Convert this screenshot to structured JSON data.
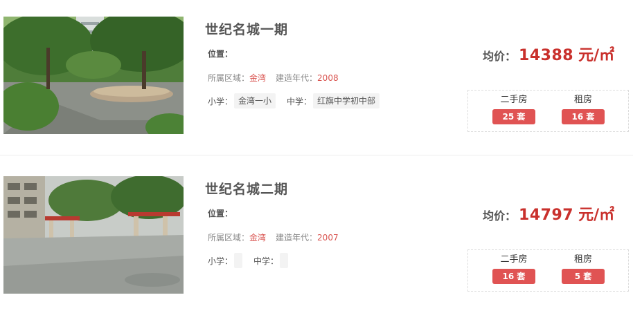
{
  "listings": [
    {
      "name": "世纪名城一期",
      "location_label": "位置：",
      "district_label": "所属区域：",
      "district": "金湾",
      "year_label": "建造年代：",
      "year": "2008",
      "primary_school_label": "小学：",
      "primary_school": "金湾一小",
      "middle_school_label": "中学：",
      "middle_school": "红旗中学初中部",
      "price_label": "均价：",
      "price": "14388",
      "price_unit": "元/㎡",
      "secondhand_label": "二手房",
      "secondhand_count": "25 套",
      "rental_label": "租房",
      "rental_count": "16 套"
    },
    {
      "name": "世纪名城二期",
      "location_label": "位置：",
      "district_label": "所属区域：",
      "district": "金湾",
      "year_label": "建造年代：",
      "year": "2007",
      "primary_school_label": "小学：",
      "primary_school": "",
      "middle_school_label": "中学：",
      "middle_school": "",
      "price_label": "均价：",
      "price": "14797",
      "price_unit": "元/㎡",
      "secondhand_label": "二手房",
      "secondhand_count": "16 套",
      "rental_label": "租房",
      "rental_count": "5 套"
    }
  ],
  "colors": {
    "accent_red": "#c9302c",
    "button_red": "#e05353",
    "highlight": "#d9534f"
  }
}
